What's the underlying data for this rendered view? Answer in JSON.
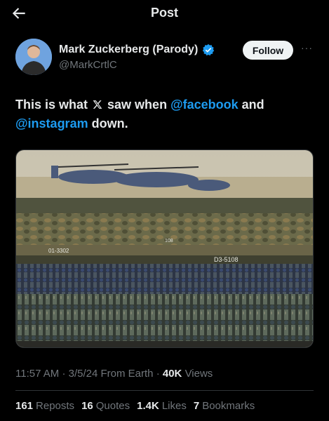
{
  "header": {
    "title": "Post"
  },
  "author": {
    "name": "Mark Zuckerberg (Parody)",
    "handle": "@MarkCrtlC",
    "verified_color": "#1d9bf0"
  },
  "follow_label": "Follow",
  "more_label": "···",
  "tweet": {
    "part1": "This is what ",
    "part2": " saw when ",
    "mention1": "@facebook",
    "part3": " and",
    "mention2": "@instagram",
    "part4": " down."
  },
  "media": {
    "vehicle_numbers": [
      "01-3302",
      "D3-5108",
      "108"
    ]
  },
  "meta": {
    "time": "11:57 AM",
    "date": "3/5/24",
    "source": "From Earth",
    "views_count": "40K",
    "views_label": "Views",
    "sep": "·"
  },
  "stats": [
    {
      "num": "161",
      "label": "Reposts"
    },
    {
      "num": "16",
      "label": "Quotes"
    },
    {
      "num": "1.4K",
      "label": "Likes"
    },
    {
      "num": "7",
      "label": "Bookmarks"
    }
  ],
  "colors": {
    "accent": "#1d9bf0",
    "muted": "#71767b",
    "text": "#e7e9ea",
    "bg": "#000000"
  },
  "icons": {
    "back": "arrow-left-icon",
    "verified": "verified-badge-icon",
    "more": "more-dots-icon",
    "x": "x-logo-icon"
  }
}
